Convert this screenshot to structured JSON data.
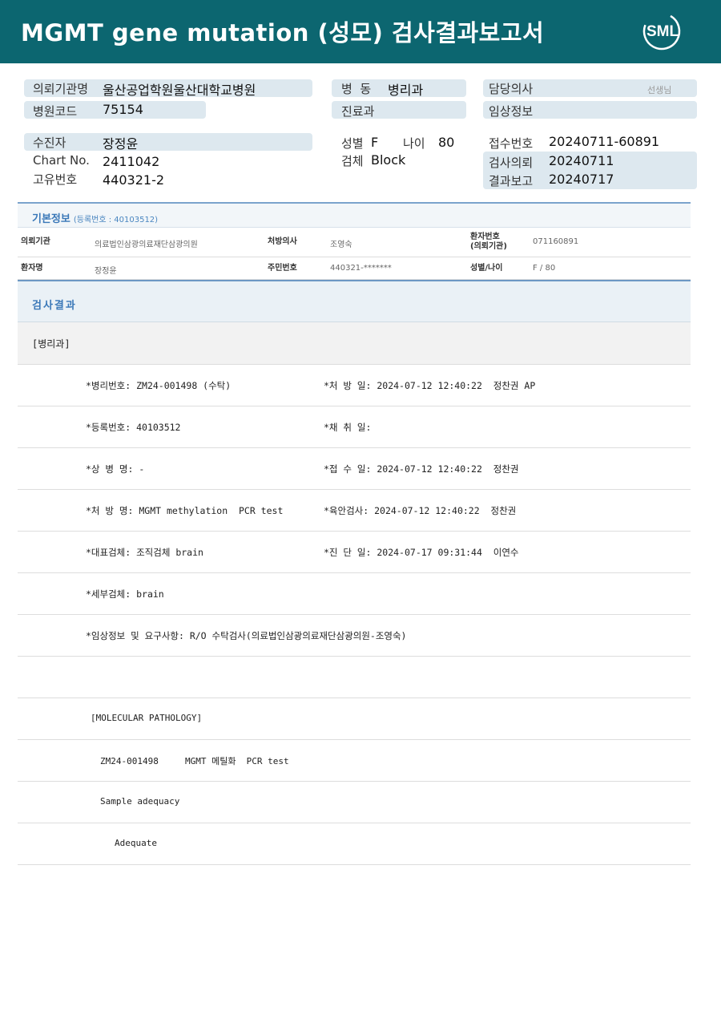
{
  "header": {
    "title": "MGMT gene mutation (성모) 검사결과보고서",
    "logo_text": "SML",
    "bg_color": "#0c6670"
  },
  "request_info": {
    "institution_label": "의뢰기관명",
    "institution_value": "울산공업학원울산대학교병원",
    "hospital_code_label": "병원코드",
    "hospital_code_value": "75154",
    "ward_label": "병  동",
    "ward_value": "병리과",
    "department_label": "진료과",
    "department_value": "",
    "doctor_label": "담당의사",
    "doctor_suffix": "선생님",
    "clinical_info_label": "임상정보",
    "clinical_info_value": ""
  },
  "patient_info": {
    "name_label": "수진자",
    "name_value": "장정윤",
    "chart_label": "Chart No.",
    "chart_value": "2411042",
    "unique_label": "고유번호",
    "unique_value": "440321-2",
    "sex_label": "성별",
    "sex_value": "F",
    "age_label": "나이",
    "age_value": "80",
    "specimen_label": "검체",
    "specimen_value": "Block",
    "receipt_label": "접수번호",
    "receipt_value": "20240711-60891",
    "request_date_label": "검사의뢰",
    "request_date_value": "20240711",
    "report_date_label": "결과보고",
    "report_date_value": "20240717"
  },
  "basic_info": {
    "title": "기본정보",
    "reg_no": "(등록번호 : 40103512)",
    "rows": [
      [
        {
          "label": "의뢰기관",
          "value": "의료법인삼광의료재단삼광의원"
        },
        {
          "label": "처방의사",
          "value": "조영숙"
        },
        {
          "label_line1": "환자번호",
          "label_line2": "(의뢰기관)",
          "value": "071160891"
        }
      ],
      [
        {
          "label": "환자명",
          "value": "장정윤"
        },
        {
          "label": "주민번호",
          "value": "440321-*******"
        },
        {
          "label": "성별/나이",
          "value": "F / 80"
        }
      ]
    ]
  },
  "results": {
    "title": "검사결과",
    "dept": "[병리과]",
    "rows": [
      {
        "left": "*병리번호: ZM24-001498 (수탁)",
        "right": "*처 방 일: 2024-07-12 12:40:22  정찬권 AP"
      },
      {
        "left": "*등록번호: 40103512",
        "right": "*채 취 일:"
      },
      {
        "left": "*상 병 명: -",
        "right": "*접 수 일: 2024-07-12 12:40:22  정찬권"
      },
      {
        "left": "*처 방 명: MGMT methylation  PCR test",
        "right": "*육안검사: 2024-07-12 12:40:22  정찬권"
      },
      {
        "left": "*대표검체: 조직검체 brain",
        "right": "*진 단 일: 2024-07-17 09:31:44  이연수"
      },
      {
        "left": "*세부검체: brain",
        "right": ""
      },
      {
        "left": "*임상정보 및 요구사항: R/O 수탁검사(의료법인삼광의료재단삼광의원-조영숙)",
        "right": ""
      },
      {
        "left": "",
        "right": ""
      }
    ],
    "molecular": [
      "[MOLECULAR PATHOLOGY]",
      "ZM24-001498     MGMT 메틸화  PCR test",
      "Sample adequacy",
      "Adequate"
    ]
  }
}
